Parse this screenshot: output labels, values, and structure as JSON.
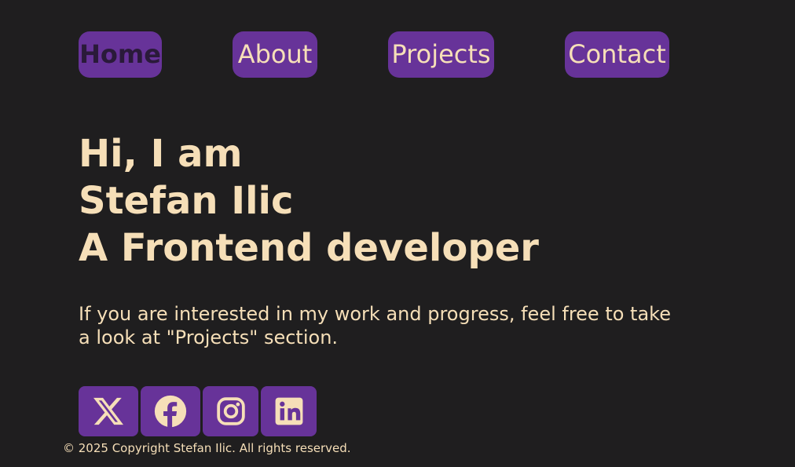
{
  "nav": {
    "items": [
      {
        "label": "Home",
        "active": true
      },
      {
        "label": "About",
        "active": false
      },
      {
        "label": "Projects",
        "active": false
      },
      {
        "label": "Contact",
        "active": false
      }
    ]
  },
  "hero": {
    "line1": "Hi, I am",
    "line2": "Stefan Ilic",
    "line3": "A Frontend developer"
  },
  "intro": {
    "text": "If you are interested in my work and progress, feel free to take a look at \"Projects\" section."
  },
  "socials": {
    "items": [
      {
        "icon": "x-icon"
      },
      {
        "icon": "facebook-icon"
      },
      {
        "icon": "instagram-icon"
      },
      {
        "icon": "linkedin-icon"
      }
    ]
  },
  "footer": {
    "text": "© 2025 Copyright Stefan Ilic. All rights reserved."
  },
  "colors": {
    "background": "#1f1e1f",
    "accent": "#673399",
    "text": "#f6dfb8",
    "active_text": "#2a1a3a"
  }
}
